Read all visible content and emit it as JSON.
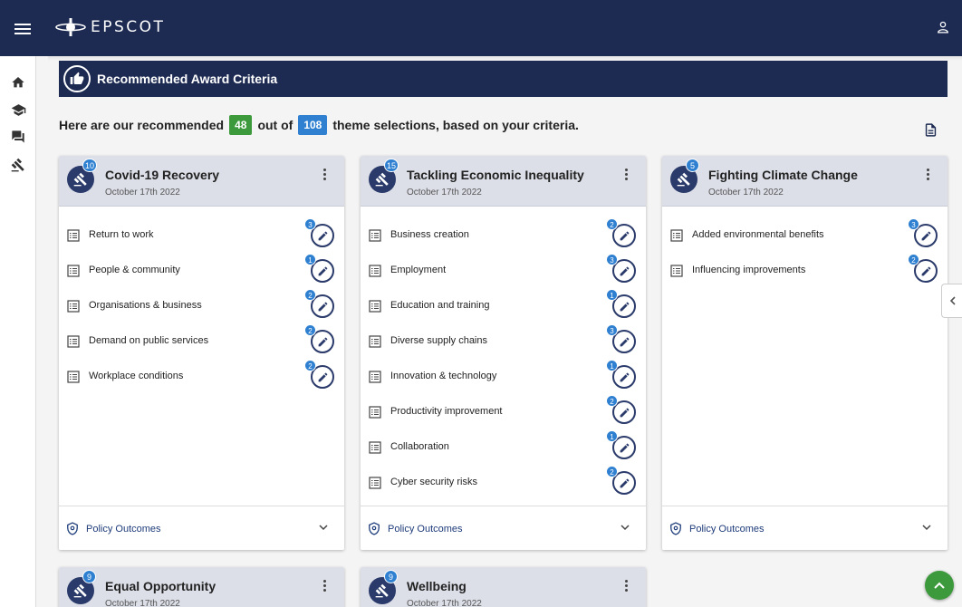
{
  "app": {
    "brand": "EPSCOT"
  },
  "section": {
    "title": "Recommended Award Criteria"
  },
  "summary": {
    "prefix": "Here are our recommended",
    "selected": "48",
    "middle": "out of",
    "total": "108",
    "suffix": "theme selections, based on your criteria."
  },
  "cards": [
    {
      "title": "Covid-19 Recovery",
      "date": "October 17th 2022",
      "count": "10",
      "footer": "Policy Outcomes",
      "items": [
        {
          "label": "Return to work",
          "badge": "3"
        },
        {
          "label": "People & community",
          "badge": "1"
        },
        {
          "label": "Organisations & business",
          "badge": "2"
        },
        {
          "label": "Demand on public services",
          "badge": "2"
        },
        {
          "label": "Workplace conditions",
          "badge": "2"
        }
      ]
    },
    {
      "title": "Tackling Economic Inequality",
      "date": "October 17th 2022",
      "count": "15",
      "footer": "Policy Outcomes",
      "items": [
        {
          "label": "Business creation",
          "badge": "2"
        },
        {
          "label": "Employment",
          "badge": "3"
        },
        {
          "label": "Education and training",
          "badge": "1"
        },
        {
          "label": "Diverse supply chains",
          "badge": "3"
        },
        {
          "label": "Innovation & technology",
          "badge": "1"
        },
        {
          "label": "Productivity improvement",
          "badge": "2"
        },
        {
          "label": "Collaboration",
          "badge": "1"
        },
        {
          "label": "Cyber security risks",
          "badge": "2"
        }
      ]
    },
    {
      "title": "Fighting Climate Change",
      "date": "October 17th 2022",
      "count": "5",
      "footer": "Policy Outcomes",
      "items": [
        {
          "label": "Added environmental benefits",
          "badge": "3"
        },
        {
          "label": "Influencing improvements",
          "badge": "2"
        }
      ]
    },
    {
      "title": "Equal Opportunity",
      "date": "October 17th 2022",
      "count": "9",
      "footer": "",
      "items": []
    },
    {
      "title": "Wellbeing",
      "date": "October 17th 2022",
      "count": "9",
      "footer": "",
      "items": []
    }
  ],
  "icons": {
    "menu": "hamburger-icon",
    "user": "account-icon",
    "home": "home-icon",
    "learning": "graduation-cap-icon",
    "messages": "chat-icon",
    "awards": "gavel-icon",
    "export": "document-icon",
    "list": "list-icon",
    "edit": "pencil-icon",
    "policy": "shield-icon",
    "expand": "chevron-down-icon",
    "collapse-panel": "chevron-left-icon",
    "scroll-top": "chevron-up-icon"
  },
  "colors": {
    "navy": "#1d2b53",
    "header_grey": "#dcdfe8",
    "badge_blue": "#2f80d1",
    "green": "#3c9a3c"
  }
}
